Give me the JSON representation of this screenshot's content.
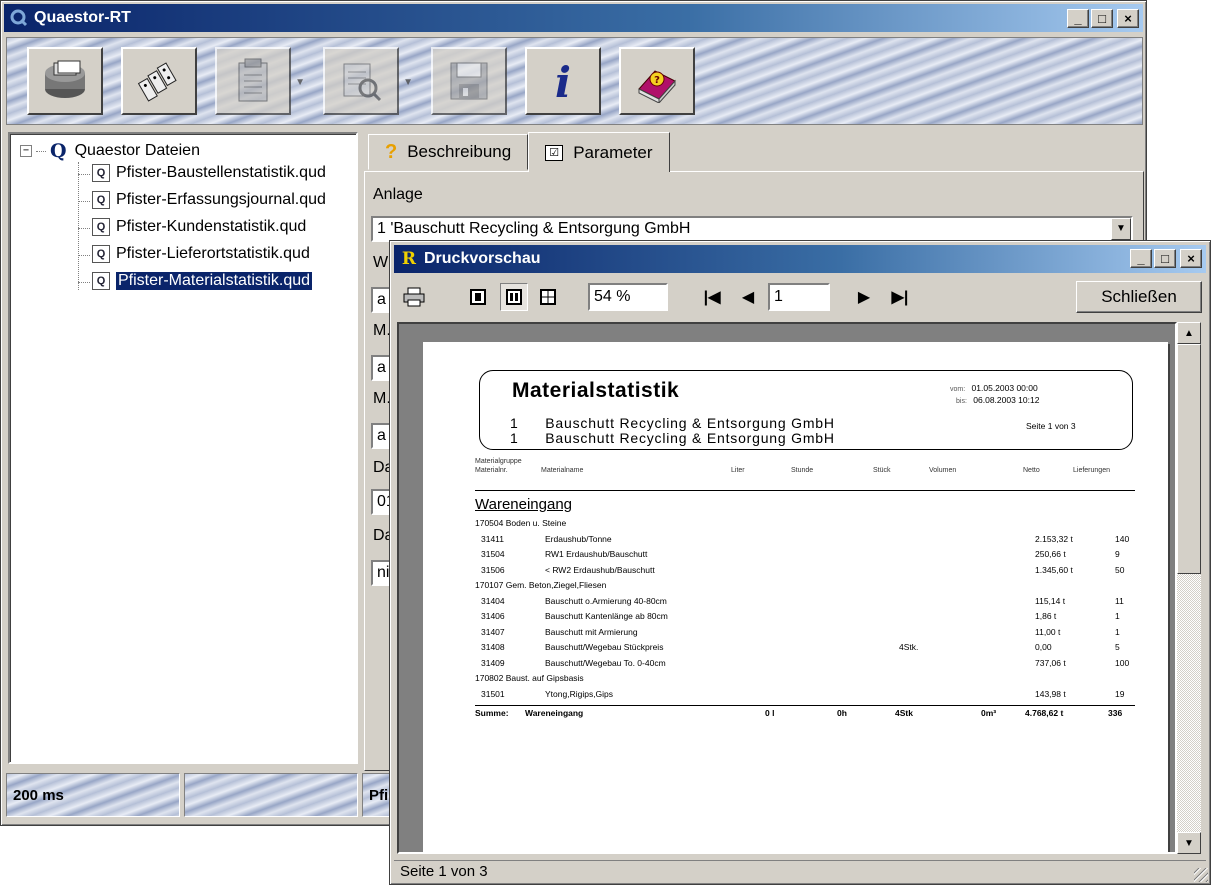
{
  "main_window": {
    "title": "Quaestor-RT",
    "controls": {
      "minimize": "_",
      "maximize": "□",
      "close": "×"
    }
  },
  "toolbar": {
    "buttons": [
      {
        "name": "database-icon",
        "enabled": true
      },
      {
        "name": "dominoes-icon",
        "enabled": true
      },
      {
        "name": "clipboard-icon",
        "enabled": false,
        "dropdown": true
      },
      {
        "name": "print-preview-icon",
        "enabled": false,
        "dropdown": true
      },
      {
        "name": "save-icon",
        "enabled": false
      },
      {
        "name": "info-icon",
        "enabled": true
      },
      {
        "name": "help-book-icon",
        "enabled": true
      }
    ]
  },
  "tree": {
    "root_label": "Quaestor Dateien",
    "expander": "−",
    "root_icon": "Q",
    "file_icon_letter": "Q",
    "items": [
      {
        "label": "Pfister-Baustellenstatistik.qud",
        "selected": false
      },
      {
        "label": "Pfister-Erfassungsjournal.qud",
        "selected": false
      },
      {
        "label": "Pfister-Kundenstatistik.qud",
        "selected": false
      },
      {
        "label": "Pfister-Lieferortstatistik.qud",
        "selected": false
      },
      {
        "label": "Pfister-Materialstatistik.qud",
        "selected": true
      }
    ]
  },
  "tabs": [
    {
      "label": "Beschreibung",
      "icon": "question-icon",
      "active": false
    },
    {
      "label": "Parameter",
      "icon": "checklist-icon",
      "active": true
    }
  ],
  "parameters": {
    "anlage_label": "Anlage",
    "anlage_value": "1 'Bauschutt Recycling & Entsorgung GmbH",
    "partial_labels": [
      "W",
      "M.",
      "M.",
      "Da",
      "Da"
    ],
    "partial_values": [
      "a",
      "a",
      "a",
      "01",
      "ni"
    ]
  },
  "status": {
    "left": "200 ms",
    "right": "Pfi"
  },
  "preview": {
    "title": "Druckvorschau",
    "title_icon": "R",
    "zoom": "54 %",
    "page": "1",
    "close_label": "Schließen",
    "nav": {
      "first": "|◀",
      "prev": "◀",
      "next": "▶",
      "last": "▶|"
    },
    "status_text": "Seite 1 von 3"
  },
  "report": {
    "title": "Materialstatistik",
    "lines": [
      {
        "num": "1",
        "text": "Bauschutt Recycling & Entsorgung GmbH"
      },
      {
        "num": "1",
        "text": "Bauschutt Recycling & Entsorgung GmbH"
      }
    ],
    "von_label": "vom:",
    "von_value": "01.05.2003 00:00",
    "bis_label": "bis:",
    "bis_value": "06.08.2003 10:12",
    "page_info": "Seite 1 von 3",
    "header_top": "Materialgruppe",
    "columns": [
      "Materialnr.",
      "Materialname",
      "Liter",
      "Stunde",
      "Stück",
      "Volumen",
      "Netto",
      "Lieferungen"
    ],
    "group": "Wareneingang",
    "rows": [
      {
        "type": "sub",
        "text": "170504 Boden u. Steine"
      },
      {
        "type": "item",
        "nr": "31411",
        "name": "Erdaushub/Tonne",
        "stueck": "",
        "netto": "2.153,32 t",
        "lief": "140"
      },
      {
        "type": "item",
        "nr": "31504",
        "name": "RW1 Erdaushub/Bauschutt",
        "stueck": "",
        "netto": "250,66 t",
        "lief": "9"
      },
      {
        "type": "item",
        "nr": "31506",
        "name": "< RW2 Erdaushub/Bauschutt",
        "stueck": "",
        "netto": "1.345,60 t",
        "lief": "50"
      },
      {
        "type": "sub",
        "text": "170107 Gem. Beton,Ziegel,Fliesen"
      },
      {
        "type": "item",
        "nr": "31404",
        "name": "Bauschutt o.Armierung 40-80cm",
        "stueck": "",
        "netto": "115,14 t",
        "lief": "11"
      },
      {
        "type": "item",
        "nr": "31406",
        "name": "Bauschutt Kantenlänge ab 80cm",
        "stueck": "",
        "netto": "1,86 t",
        "lief": "1"
      },
      {
        "type": "item",
        "nr": "31407",
        "name": "Bauschutt mit Armierung",
        "stueck": "",
        "netto": "11,00 t",
        "lief": "1"
      },
      {
        "type": "item",
        "nr": "31408",
        "name": "Bauschutt/Wegebau Stückpreis",
        "stueck": "4Stk.",
        "netto": "0,00",
        "lief": "5"
      },
      {
        "type": "item",
        "nr": "31409",
        "name": "Bauschutt/Wegebau To. 0-40cm",
        "stueck": "",
        "netto": "737,06 t",
        "lief": "100"
      },
      {
        "type": "sub",
        "text": "170802 Baust. auf Gipsbasis"
      },
      {
        "type": "item",
        "nr": "31501",
        "name": "Ytong,Rigips,Gips",
        "stueck": "",
        "netto": "143,98 t",
        "lief": "19"
      }
    ],
    "summary": {
      "label": "Summe:",
      "group": "Wareneingang",
      "liter": "0 l",
      "stunde": "0h",
      "stueck": "4Stk",
      "volumen": "0m³",
      "netto": "4.768,62 t",
      "lief": "336"
    }
  }
}
